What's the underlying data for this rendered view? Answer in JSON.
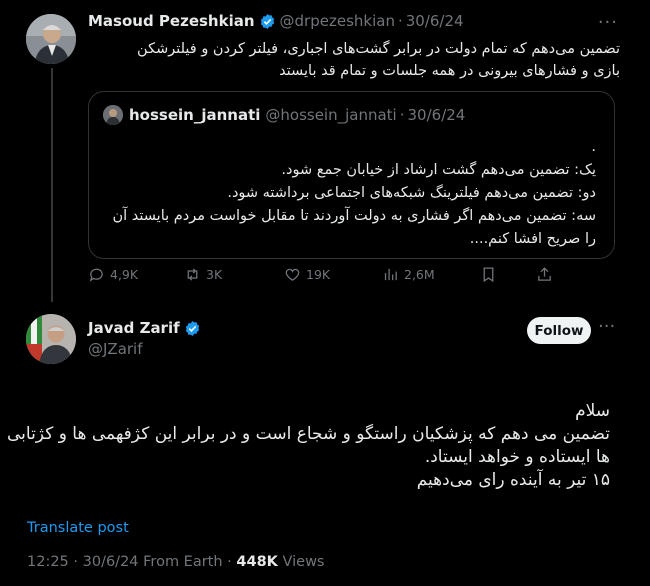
{
  "parent_tweet": {
    "name": "Masoud Pezeshkian",
    "handle": "@drpezeshkian",
    "separator": "·",
    "date": "30/6/24",
    "text_lines": [
      "تضمین می‌دهم که تمام دولت در برابر  گشت‌های اجباری، فیلتر کردن و فیلترشکن",
      "بازی و فشارهای بیرونی در همه جلسات و تمام قد بایستد"
    ],
    "quoted": {
      "name": "hossein_jannati",
      "handle": "@hossein_jannati",
      "separator": "·",
      "date": "30/6/24",
      "text_lines": [
        ".",
        "یک: تضمین می‌دهم گشت ارشاد از خیابان جمع شود.",
        "دو: تضمین می‌دهم فیلترینگ شبکه‌های اجتماعی برداشته شود.",
        "سه: تضمین می‌دهم اگر فشاری به دولت آوردند تا مقابل خواست مردم بایستد آن",
        "را صریح افشا کنم...."
      ]
    },
    "actions": {
      "replies": "4,9K",
      "reposts": "3K",
      "likes": "19K",
      "views": "2,6M"
    },
    "more_label": "···"
  },
  "main_tweet": {
    "name": "Javad Zarif",
    "handle": "@JZarif",
    "follow_label": "Follow",
    "more_label": "···",
    "text_lines": [
      "سلام",
      "تضمین می دهم که پزشکیان راستگو و شجاع است و  در برابر این کژفهمی ها و کژتابی",
      "ها ایستاده و خواهد ایستاد.",
      "۱۵ تیر به آینده رای می‌دهیم"
    ],
    "translate_label": "Translate post",
    "time": "12:25",
    "separator": "·",
    "date": "30/6/24",
    "source": "From Earth",
    "views_count": "448K",
    "views_label": "Views"
  },
  "colors": {
    "background": "#000000",
    "text": "#e7e9ea",
    "muted": "#71767b",
    "accent": "#1d9bf0",
    "border": "#2f3336"
  },
  "icons": [
    "verified-badge-icon",
    "reply-icon",
    "repost-icon",
    "like-icon",
    "views-icon",
    "bookmark-icon",
    "share-icon"
  ]
}
